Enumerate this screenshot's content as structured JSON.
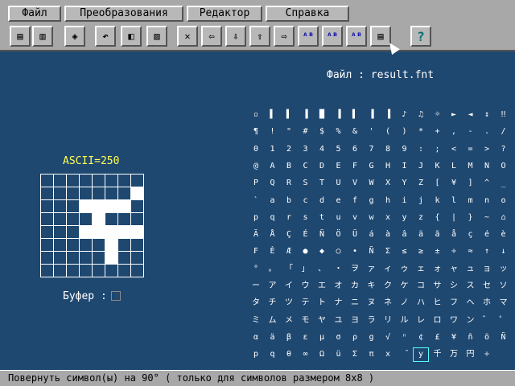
{
  "menu": {
    "items": [
      {
        "label": "Файл",
        "name": "menu-file"
      },
      {
        "label": "Преобразования",
        "name": "menu-transform"
      },
      {
        "label": "Редактор",
        "name": "menu-editor"
      },
      {
        "label": "Справка",
        "name": "menu-help"
      }
    ]
  },
  "toolbar": {
    "buttons": [
      {
        "name": "open-file-button",
        "icon": "open-file-icon",
        "glyph": "▤"
      },
      {
        "name": "save-file-button",
        "icon": "save-file-icon",
        "glyph": "▥"
      },
      {
        "name": "settings-button",
        "icon": "chip-icon",
        "glyph": "◈"
      },
      {
        "name": "undo-button",
        "icon": "undo-icon",
        "glyph": "↶"
      },
      {
        "name": "mirror-button",
        "icon": "mirror-icon",
        "glyph": "◧"
      },
      {
        "name": "copy-button",
        "icon": "copy-icon",
        "glyph": "▧"
      },
      {
        "name": "clear-button",
        "icon": "close-icon",
        "glyph": "✕"
      },
      {
        "name": "shift-left-button",
        "icon": "arrow-left-icon",
        "glyph": "⇦"
      },
      {
        "name": "shift-down-button",
        "icon": "arrow-down-icon",
        "glyph": "⇩"
      },
      {
        "name": "shift-up-button",
        "icon": "arrow-up-icon",
        "glyph": "⇧"
      },
      {
        "name": "shift-right-button",
        "icon": "arrow-right-icon",
        "glyph": "⇨"
      },
      {
        "name": "ab-button-1",
        "icon": "ab-icon",
        "glyph": "ᴬᴮ"
      },
      {
        "name": "ab-button-2",
        "icon": "ab-icon",
        "glyph": "ᴬᴮ"
      },
      {
        "name": "ab-button-3",
        "icon": "ab-icon",
        "glyph": "ᴬᴮ"
      },
      {
        "name": "rotate-button",
        "icon": "rotate-icon",
        "glyph": "▤"
      },
      {
        "name": "help-button",
        "icon": "question-icon",
        "glyph": "?"
      }
    ]
  },
  "file_label": "Файл : result.fnt",
  "ascii_label": "ASCII=250",
  "grid": {
    "on_cells": [
      [
        1,
        7
      ],
      [
        2,
        3
      ],
      [
        2,
        4
      ],
      [
        2,
        5
      ],
      [
        2,
        6
      ],
      [
        3,
        4
      ],
      [
        4,
        3
      ],
      [
        4,
        4
      ],
      [
        4,
        5
      ],
      [
        4,
        6
      ],
      [
        4,
        7
      ],
      [
        5,
        5
      ],
      [
        6,
        5
      ]
    ]
  },
  "buffer_label": "Буфер :",
  "charset_rows": [
    "▫▌▌▐█▐▌▐▐♪♫☼►◄↕‼",
    "¶!\"#$%&'()*+,-./",
    "0123456789:;<=>?",
    "@ABCDEFGHIJKLMNO",
    "PQRSTUVWXYZ[¥]^_",
    "`abcdefghijklmno",
    "pqrstuvwxyz{|}~⌂",
    "ÄÅÇÉÑÖÜáàâäãåçéè",
    "₣ÈÆ●◆○•ÑΣ≤≥±÷≈↑↓",
    "°。「」、・ヲァィゥェォャュョッ",
    "ーアイウエオカキクケコサシスセソ",
    "タチツテトナニヌネノハヒフヘホマ",
    "ミムメモヤユヨラリルレロワン゛゜",
    "αäβεμσρg√ⁿ¢£¥ñöÑ",
    "pqθ∞ΩüΣπx̄y千万円÷ ■"
  ],
  "selected_char": {
    "row": 14,
    "col": 10
  },
  "status_text": "Повернуть символ(ы) на 90° ( только для символов размером 8x8 )"
}
